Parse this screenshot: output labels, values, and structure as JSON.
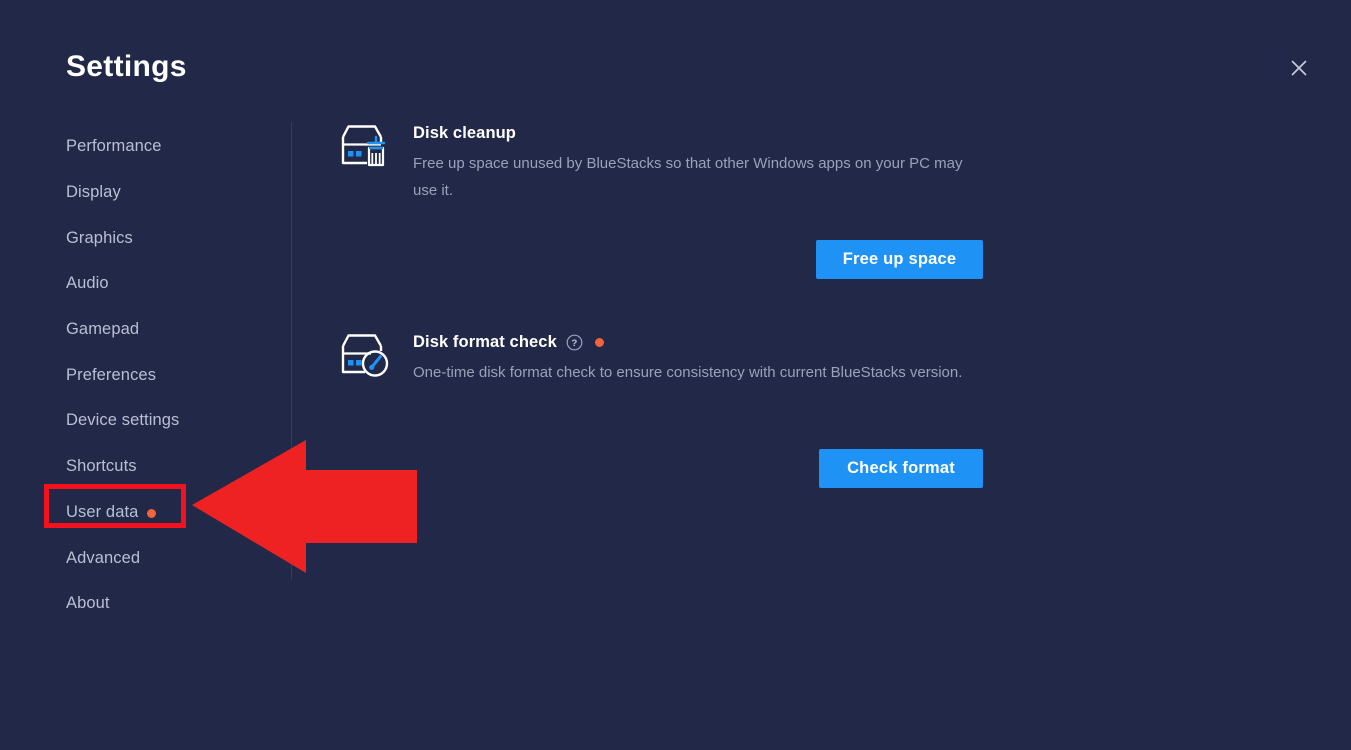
{
  "window": {
    "title": "Settings",
    "close_icon": "close-icon",
    "background_color": "#222847"
  },
  "sidebar": {
    "items": [
      {
        "label": "Performance",
        "badge": false
      },
      {
        "label": "Display",
        "badge": false
      },
      {
        "label": "Graphics",
        "badge": false
      },
      {
        "label": "Audio",
        "badge": false
      },
      {
        "label": "Gamepad",
        "badge": false
      },
      {
        "label": "Preferences",
        "badge": false
      },
      {
        "label": "Device settings",
        "badge": false
      },
      {
        "label": "Shortcuts",
        "badge": false
      },
      {
        "label": "User data",
        "badge": true
      },
      {
        "label": "Advanced",
        "badge": false
      },
      {
        "label": "About",
        "badge": false
      }
    ],
    "selected": "User data"
  },
  "main": {
    "sections": [
      {
        "icon": "disk-cleanup-icon",
        "title": "Disk cleanup",
        "description": "Free up space unused by BlueStacks so that other Windows apps on your PC may use it.",
        "has_help_icon": false,
        "has_badge": false,
        "button": "Free up space"
      },
      {
        "icon": "disk-format-check-icon",
        "title": "Disk format check",
        "description": "One-time disk format check to ensure consistency with current BlueStacks version.",
        "has_help_icon": true,
        "help_icon": "question-mark-circle-icon",
        "has_badge": true,
        "button": "Check format"
      }
    ]
  },
  "annotation": {
    "highlight_target": "User data",
    "highlight_color": "#f5111e",
    "arrow_color": "#ee2222",
    "arrow_direction": "left"
  },
  "colors": {
    "accent_blue": "#1e93f5",
    "badge_orange": "#f2653c",
    "background": "#222847",
    "muted_text": "#9aa1ba",
    "sidebar_text": "#b9bfd4"
  }
}
